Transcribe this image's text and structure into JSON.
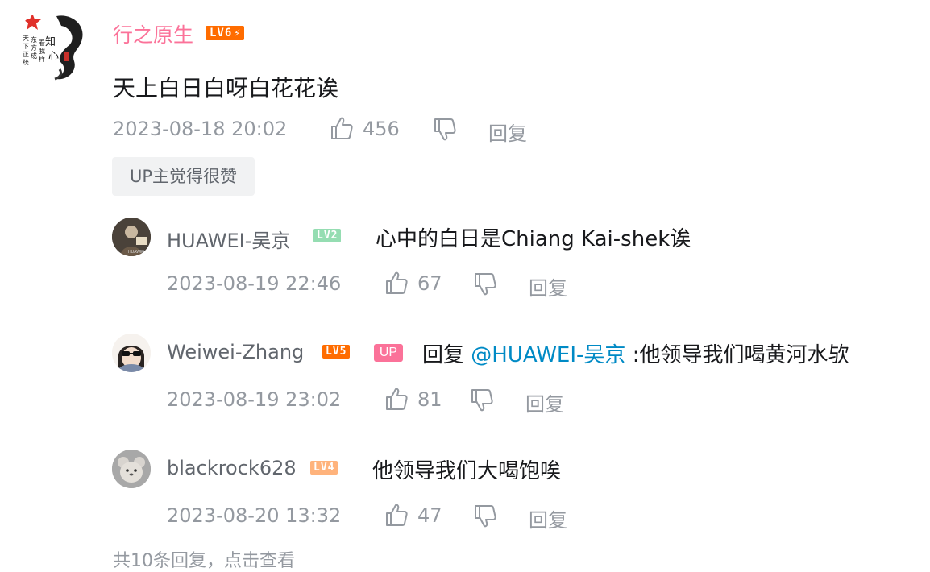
{
  "main_comment": {
    "username": "行之原生",
    "level_badge": "LV6",
    "text": "天上白日白呀白花花诶",
    "timestamp": "2023-08-18 20:02",
    "like_count": "456",
    "reply_label": "回复",
    "up_liked_tag": "UP主觉得很赞",
    "username_color": "#fb7299",
    "badge_color": "#ff6c00"
  },
  "replies": [
    {
      "username": "HUAWEI-吴京",
      "level_badge": "LV2",
      "text": "心中的白日是Chiang Kai-shek诶",
      "timestamp": "2023-08-19 22:46",
      "like_count": "67",
      "reply_label": "回复",
      "badge_color": "#95ddb2"
    },
    {
      "username": "Weiwei-Zhang",
      "level_badge": "LV5",
      "up_badge": "UP",
      "reply_prefix": "回复",
      "mention": "@HUAWEI-吴京",
      "text": ":他领导我们喝黄河水欤",
      "timestamp": "2023-08-19 23:02",
      "like_count": "81",
      "reply_label": "回复",
      "badge_color": "#ff6c00"
    },
    {
      "username": "blackrock628",
      "level_badge": "LV4",
      "text": "他领导我们大喝饱唉",
      "timestamp": "2023-08-20 13:32",
      "like_count": "47",
      "reply_label": "回复",
      "badge_color": "#ffb37c"
    }
  ],
  "footer_text": "共10条回复，点击查看",
  "colors": {
    "meta_text": "#9499a0",
    "mention": "#008ac5",
    "up_badge": "#fb7299"
  }
}
